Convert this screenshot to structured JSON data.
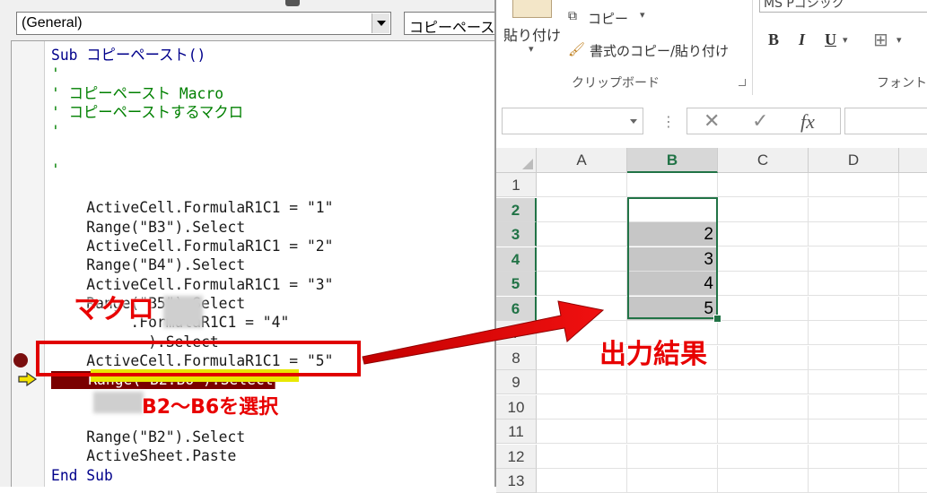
{
  "vba": {
    "procedure_combo": "(General)",
    "object_combo": "コピーペースト",
    "code_lines": [
      {
        "text": "Sub コピーペースト()",
        "kind": "sub"
      },
      {
        "text": "'",
        "kind": "comment"
      },
      {
        "text": "' コピーペースト Macro",
        "kind": "comment"
      },
      {
        "text": "' コピーペーストするマクロ",
        "kind": "comment"
      },
      {
        "text": "'",
        "kind": "comment"
      },
      {
        "text": "",
        "kind": "blank"
      },
      {
        "text": "'",
        "kind": "comment"
      },
      {
        "text": "",
        "kind": "blank"
      },
      {
        "text": "    ActiveCell.FormulaR1C1 = \"1\"",
        "kind": "code"
      },
      {
        "text": "    Range(\"B3\").Select",
        "kind": "code"
      },
      {
        "text": "    ActiveCell.FormulaR1C1 = \"2\"",
        "kind": "code"
      },
      {
        "text": "    Range(\"B4\").Select",
        "kind": "code"
      },
      {
        "text": "    ActiveCell.FormulaR1C1 = \"3\"",
        "kind": "code"
      },
      {
        "text": "    Range(\"B5\").Select",
        "kind": "code"
      },
      {
        "text": "         .FormulaR1C1 = \"4\"",
        "kind": "code"
      },
      {
        "text": "           ).Select",
        "kind": "code"
      },
      {
        "text": "    ActiveCell.FormulaR1C1 = \"5\"",
        "kind": "code"
      },
      {
        "text": "    Range(\"B2:B6\").Select",
        "kind": "break"
      },
      {
        "text": "",
        "kind": "exec"
      },
      {
        "text": "",
        "kind": "blank"
      },
      {
        "text": "    Range(\"B2\").Select",
        "kind": "code"
      },
      {
        "text": "    ActiveSheet.Paste",
        "kind": "code"
      },
      {
        "text": "End Sub",
        "kind": "sub"
      }
    ]
  },
  "annotations": {
    "macro_label": "マクロ",
    "select_label": "B2～B6を選択",
    "result_label": "出力結果"
  },
  "excel": {
    "ribbon": {
      "paste": "貼り付け",
      "copy": "コピー",
      "format_painter": "書式のコピー/貼り付け",
      "clipboard_group": "クリップボード",
      "font_group": "フォント",
      "font_name": "MS Pゴシック",
      "bold": "B",
      "italic": "I",
      "underline": "U"
    },
    "formula_bar": {
      "cancel": "✕",
      "enter": "✓",
      "fx": "fx"
    },
    "columns": [
      "A",
      "B",
      "C",
      "D"
    ],
    "rows": [
      "1",
      "2",
      "3",
      "4",
      "5",
      "6",
      "7",
      "8",
      "9",
      "10",
      "11",
      "12",
      "13"
    ],
    "column_b_values": {
      "3": "2",
      "4": "3",
      "5": "4",
      "6": "5"
    },
    "selected_column": "B",
    "selected_rows": [
      "2",
      "3",
      "4",
      "5",
      "6"
    ]
  },
  "colors": {
    "annotation_red": "#e00000",
    "excel_green": "#217346",
    "breakpoint_dark_red": "#7a0000"
  }
}
